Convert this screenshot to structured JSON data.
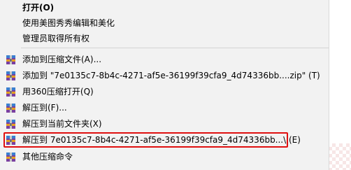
{
  "menu": {
    "open": "打开(O)",
    "meitu": "使用美图秀秀编辑和美化",
    "admin": "管理员取得所有权",
    "add_archive": "添加到压缩文件(A)...",
    "add_zip": "添加到 \"7e0135c7-8b4c-4271-af5e-36199f39cfa9_4d74336bb....zip\" (T)",
    "open_360": "用360压缩打开(Q)",
    "extract_to": "解压到(F)...",
    "extract_here": "解压到当前文件夹(X)",
    "extract_folder": "解压到 7e0135c7-8b4c-4271-af5e-36199f39cfa9_4d74336bb...\\ (E)",
    "other": "其他压缩命令"
  },
  "icons": {
    "archive": "zip-archive-icon"
  },
  "colors": {
    "highlight_border": "#e01010",
    "menu_bg": "#f2f2f2"
  }
}
